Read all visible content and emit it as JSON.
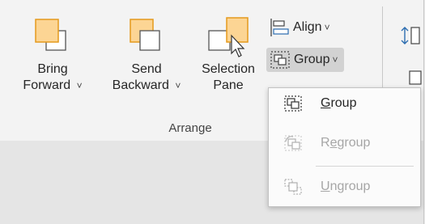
{
  "ribbon": {
    "bring_forward": {
      "line1": "Bring",
      "line2": "Forward",
      "chevron": "˅"
    },
    "send_backward": {
      "line1": "Send",
      "line2": "Backward",
      "chevron": "˅"
    },
    "selection_pane": {
      "line1": "Selection",
      "line2": "Pane"
    },
    "align": {
      "label": "Align",
      "chevron": "˅"
    },
    "group": {
      "label": "Group",
      "chevron": "˅"
    },
    "group_section_label": "Arrange"
  },
  "group_menu": {
    "items": [
      {
        "label": "Group",
        "underline": "G",
        "rest": "roup",
        "enabled": true,
        "icon": "group-icon"
      },
      {
        "label": "Regroup",
        "prefix": "R",
        "underline": "e",
        "rest": "group",
        "enabled": false,
        "icon": "regroup-icon"
      },
      {
        "label": "Ungroup",
        "underline": "U",
        "rest": "ngroup",
        "enabled": false,
        "icon": "ungroup-icon"
      }
    ]
  },
  "colors": {
    "accent_orange": "#f9b233",
    "accent_orange_fill": "#fcd594",
    "icon_blue": "#2b6cb0"
  }
}
